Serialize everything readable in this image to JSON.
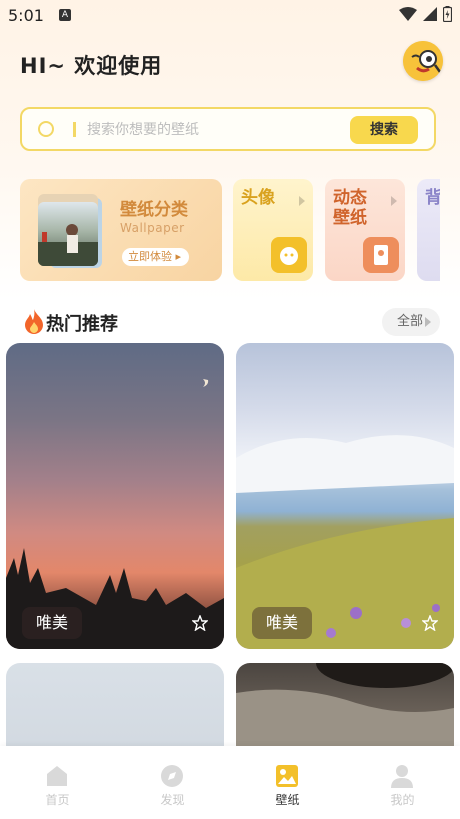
{
  "status": {
    "time": "5:01",
    "app_badge": "A"
  },
  "header": {
    "greeting": "HI~ 欢迎使用"
  },
  "search": {
    "placeholder": "搜索你想要的壁纸",
    "button": "搜索"
  },
  "categories": {
    "main": {
      "title": "壁纸分类",
      "subtitle": "Wallpaper",
      "cta": "立即体验"
    },
    "avatar": {
      "label": "头像"
    },
    "live": {
      "line1": "动态",
      "line2": "壁纸"
    },
    "more": {
      "label": "背"
    }
  },
  "hot": {
    "title": "热门推荐",
    "all_label": "全部"
  },
  "cards": [
    {
      "tag": "唯美"
    },
    {
      "tag": "唯美"
    }
  ],
  "tabbar": {
    "items": [
      {
        "label": "首页",
        "icon": "home-icon"
      },
      {
        "label": "发现",
        "icon": "discover-icon"
      },
      {
        "label": "壁纸",
        "icon": "wallpaper-icon"
      },
      {
        "label": "我的",
        "icon": "profile-icon"
      }
    ],
    "active_index": 2
  },
  "colors": {
    "accent": "#f8d84d",
    "accent_border": "#f3d865",
    "active_tab": "#f3c02a"
  }
}
